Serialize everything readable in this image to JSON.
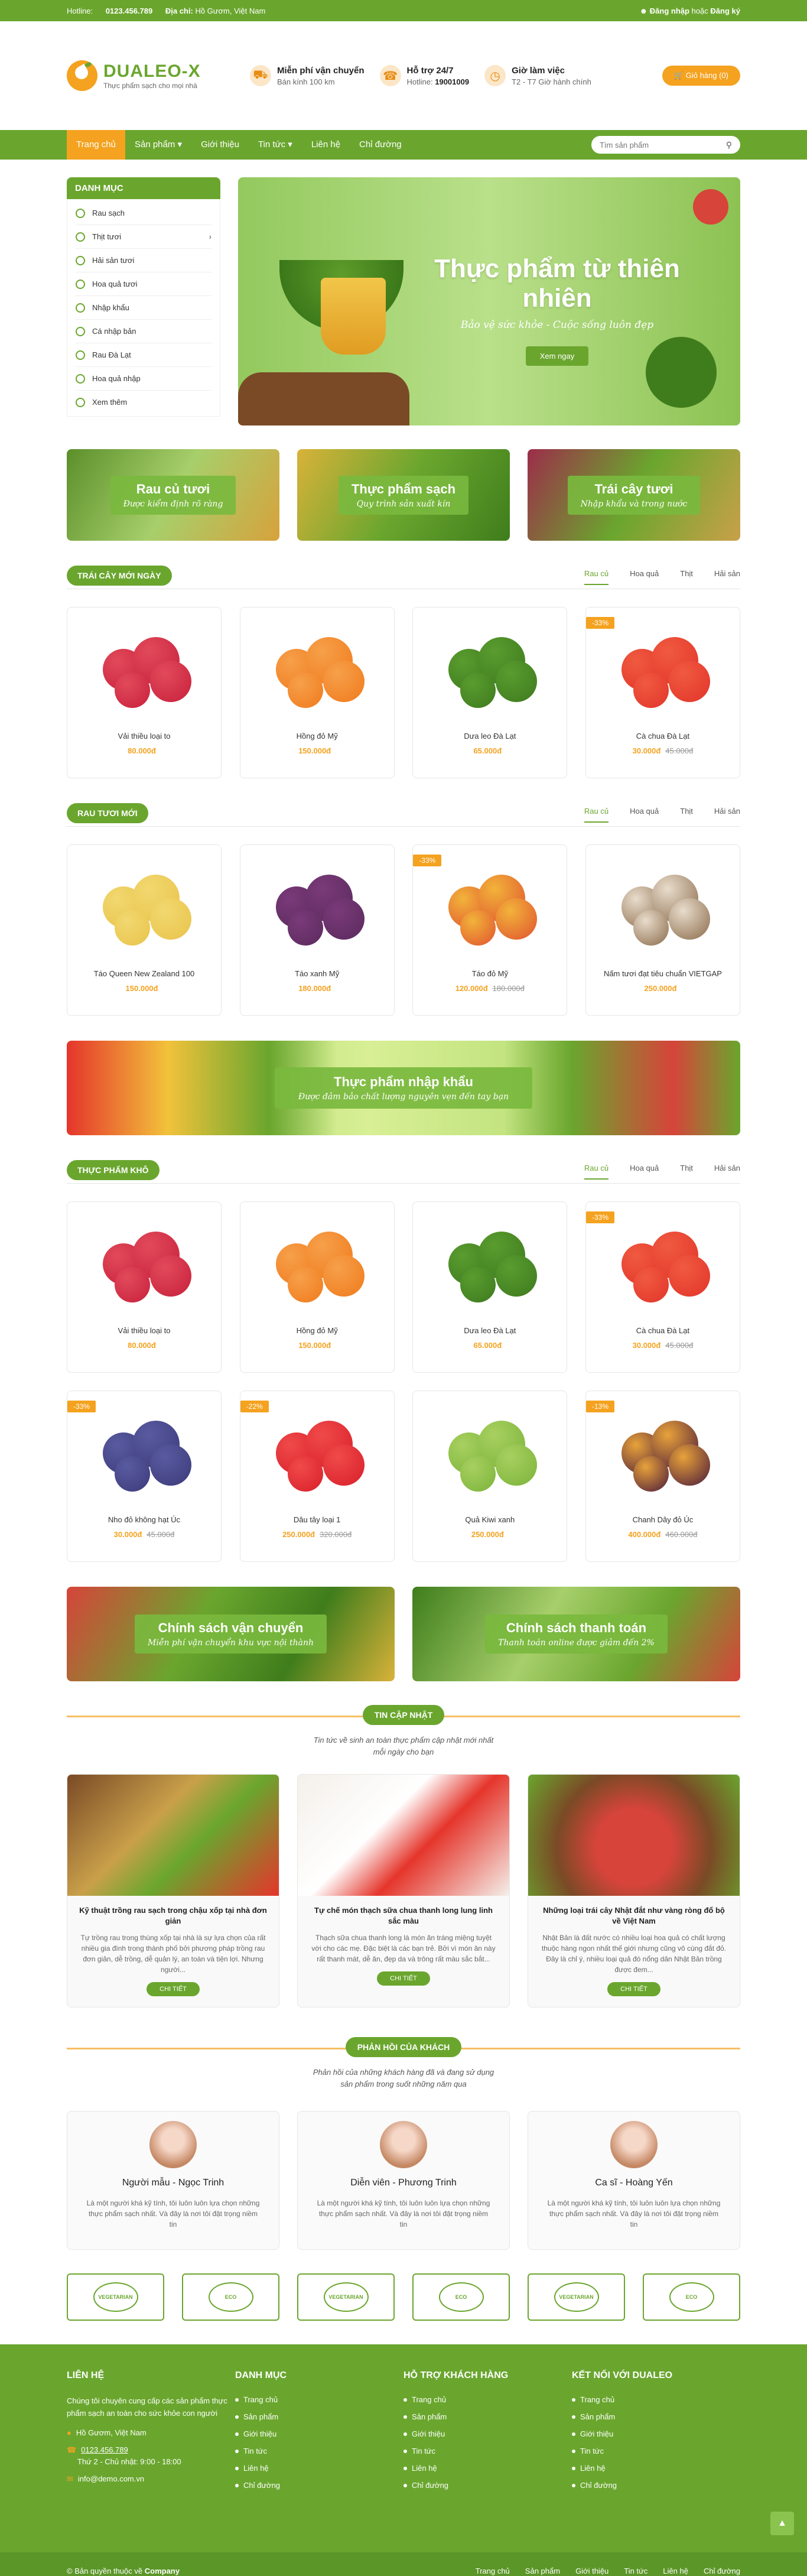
{
  "topbar": {
    "hotline_label": "Hotline:",
    "hotline": "0123.456.789",
    "address_label": "Địa chỉ:",
    "address": "Hồ Gươm, Việt Nam",
    "login": "Đăng nhập",
    "or": "hoặc",
    "register": "Đăng ký"
  },
  "brand": {
    "name": "DUALEO-X",
    "tagline": "Thực phẩm sạch cho mọi nhà",
    "color": "#6aa62e",
    "accent": "#f4a21f"
  },
  "header_info": [
    {
      "title": "Miễn phí vận chuyển",
      "text": "Bán kính 100 km",
      "icon": "truck-icon"
    },
    {
      "title": "Hỗ trợ 24/7",
      "text_label": "Hotline:",
      "text": "19001009",
      "icon": "phone-icon"
    },
    {
      "title": "Giờ làm việc",
      "text": "T2 - T7 Giờ hành chính",
      "icon": "clock-icon"
    }
  ],
  "cart": {
    "label": "Giỏ hàng (0)"
  },
  "nav": {
    "items": [
      "Trang chủ",
      "Sản phẩm",
      "Giới thiệu",
      "Tin tức",
      "Liên hệ",
      "Chỉ đường"
    ],
    "search_placeholder": "Tìm sản phẩm"
  },
  "categories": {
    "title": "DANH MỤC",
    "items": [
      "Rau sạch",
      "Thịt tươi",
      "Hải sản tươi",
      "Hoa quả tươi",
      "Nhập khẩu",
      "Cá nhập bản",
      "Rau Đà Lạt",
      "Hoa quả nhập",
      "Xem thêm"
    ]
  },
  "slider": {
    "title": "Thực phẩm từ thiên nhiên",
    "subtitle": "Bảo vệ sức khỏe - Cuộc sống luôn đẹp",
    "button": "Xem ngay"
  },
  "banners": [
    {
      "title": "Rau củ tươi",
      "sub": "Được kiểm định rõ ràng"
    },
    {
      "title": "Thực phẩm sạch",
      "sub": "Quy trình sản xuất kín"
    },
    {
      "title": "Trái cây tươi",
      "sub": "Nhập khẩu và trong nước"
    }
  ],
  "tabs": [
    "Rau củ",
    "Hoa quả",
    "Thịt",
    "Hải sản"
  ],
  "sections": [
    {
      "title": "TRÁI CÂY MỚI NGÀY",
      "products": [
        {
          "name": "Vải thiều loại to",
          "price": "80.000đ",
          "old": "",
          "sale": ""
        },
        {
          "name": "Hồng đỏ Mỹ",
          "price": "150.000đ",
          "old": "",
          "sale": ""
        },
        {
          "name": "Dưa leo Đà Lạt",
          "price": "65.000đ",
          "old": "",
          "sale": ""
        },
        {
          "name": "Cà chua Đà Lạt",
          "price": "30.000đ",
          "old": "45.000đ",
          "sale": "-33%"
        }
      ]
    },
    {
      "title": "RAU TƯƠI MỚI",
      "products": [
        {
          "name": "Táo Queen New Zealand 100",
          "price": "150.000đ",
          "old": "",
          "sale": ""
        },
        {
          "name": "Táo xanh Mỹ",
          "price": "180.000đ",
          "old": "",
          "sale": ""
        },
        {
          "name": "Táo đỏ Mỹ",
          "price": "120.000đ",
          "old": "180.000đ",
          "sale": "-33%"
        },
        {
          "name": "Nấm tươi đạt tiêu chuẩn VIETGAP",
          "price": "250.000đ",
          "old": "",
          "sale": ""
        }
      ]
    },
    {
      "title": "THỰC PHẨM KHÔ",
      "products": [
        {
          "name": "Vải thiều loại to",
          "price": "80.000đ",
          "old": "",
          "sale": ""
        },
        {
          "name": "Hồng đỏ Mỹ",
          "price": "150.000đ",
          "old": "",
          "sale": ""
        },
        {
          "name": "Dưa leo Đà Lạt",
          "price": "65.000đ",
          "old": "",
          "sale": ""
        },
        {
          "name": "Cà chua Đà Lạt",
          "price": "30.000đ",
          "old": "45.000đ",
          "sale": "-33%"
        },
        {
          "name": "Nho đỏ không hạt Úc",
          "price": "30.000đ",
          "old": "45.000đ",
          "sale": "-33%"
        },
        {
          "name": "Dâu tây loại 1",
          "price": "250.000đ",
          "old": "320.000đ",
          "sale": "-22%"
        },
        {
          "name": "Quả Kiwi xanh",
          "price": "250.000đ",
          "old": "",
          "sale": ""
        },
        {
          "name": "Chanh Dây đỏ Úc",
          "price": "400.000đ",
          "old": "460.000đ",
          "sale": "-13%"
        }
      ]
    }
  ],
  "wide_banner": {
    "title": "Thực phẩm nhập khẩu",
    "sub": "Được đảm bảo chất lượng nguyên vẹn đến tay bạn"
  },
  "policies": [
    {
      "title": "Chính sách vận chuyển",
      "sub": "Miễn phí vận chuyển khu vực nội thành"
    },
    {
      "title": "Chính sách thanh toán",
      "sub": "Thanh toán online được giảm đến 2%"
    }
  ],
  "news": {
    "title": "TIN CẬP NHẬT",
    "desc": "Tin tức về sinh an toàn thực phẩm cập nhật mới nhất mỗi ngày cho bạn",
    "button": "CHI TIẾT",
    "items": [
      {
        "title": "Kỹ thuật trồng rau sạch trong chậu xốp tại nhà đơn giản",
        "text": "Tự trồng rau trong thùng xốp tại nhà là sự lựa chọn của rất nhiều gia đình trong thành phố bởi phương pháp trồng rau đơn giản, dễ trồng, dễ quản lý, an toàn và tiện lợi. Nhưng người..."
      },
      {
        "title": "Tự chế món thạch sữa chua thanh long lung linh sắc màu",
        "text": "Thạch sữa chua thanh long là món ăn tráng miệng tuyệt vời cho các mẹ. Đặc biệt là các bạn trẻ. Bởi vì món ăn này rất thanh mát, dễ ăn, đẹp da và trông rất màu sắc bắt..."
      },
      {
        "title": "Những loại trái cây Nhật đắt như vàng ròng đổ bộ về Việt Nam",
        "text": "Nhật Bản là đất nước có nhiều loại hoa quả có chất lượng thuộc hàng ngon nhất thế giới nhưng cũng vô cùng đắt đỏ. Đây là chỉ ý, nhiều loại quả đó nổng dân Nhật Bản trồng được đem..."
      }
    ]
  },
  "testimonials": {
    "title": "PHẢN HỒI CỦA KHÁCH",
    "desc": "Phản hồi của những khách hàng đã và đang sử dụng sản phẩm trong suốt những năm qua",
    "items": [
      {
        "name": "Người mẫu - Ngọc Trinh",
        "text": "Là một người khá kỹ tính, tôi luôn luôn lựa chọn những thực phẩm sạch nhất. Và đây là nơi tôi đặt trọng niềm tin"
      },
      {
        "name": "Diễn viên - Phương Trinh",
        "text": "Là một người khá kỹ tính, tôi luôn luôn lựa chọn những thực phẩm sạch nhất. Và đây là nơi tôi đặt trọng niềm tin"
      },
      {
        "name": "Ca sĩ - Hoàng Yến",
        "text": "Là một người khá kỹ tính, tôi luôn luôn lựa chọn những thực phẩm sạch nhất. Và đây là nơi tôi đặt trọng niềm tin"
      }
    ]
  },
  "partners": [
    "VEGETARIAN",
    "ECO",
    "VEGETARIAN",
    "ECO",
    "VEGETARIAN",
    "ECO"
  ],
  "footer": {
    "contact_title": "LIÊN HỆ",
    "contact_text": "Chúng tôi chuyên cung cấp các sản phẩm thực phẩm sạch an toàn cho sức khỏe con người",
    "address": "Hồ Gươm, Việt Nam",
    "phone": "0123.456.789",
    "hours": "Thứ 2 - Chủ nhật: 9:00 - 18:00",
    "email": "info@demo.com.vn",
    "cols": [
      {
        "title": "DANH MỤC",
        "items": [
          "Trang chủ",
          "Sản phẩm",
          "Giới thiệu",
          "Tin tức",
          "Liên hệ",
          "Chỉ đường"
        ]
      },
      {
        "title": "HỖ TRỢ KHÁCH HÀNG",
        "items": [
          "Trang chủ",
          "Sản phẩm",
          "Giới thiệu",
          "Tin tức",
          "Liên hệ",
          "Chỉ đường"
        ]
      },
      {
        "title": "KẾT NỐI VỚI DUALEO",
        "items": [
          "Trang chủ",
          "Sản phẩm",
          "Giới thiệu",
          "Tin tức",
          "Liên hệ",
          "Chỉ đường"
        ]
      }
    ]
  },
  "copyright": {
    "text": "© Bản quyền thuộc về",
    "company": "Company",
    "links": [
      "Trang chủ",
      "Sản phẩm",
      "Giới thiệu",
      "Tin tức",
      "Liên hệ",
      "Chỉ đường"
    ]
  }
}
